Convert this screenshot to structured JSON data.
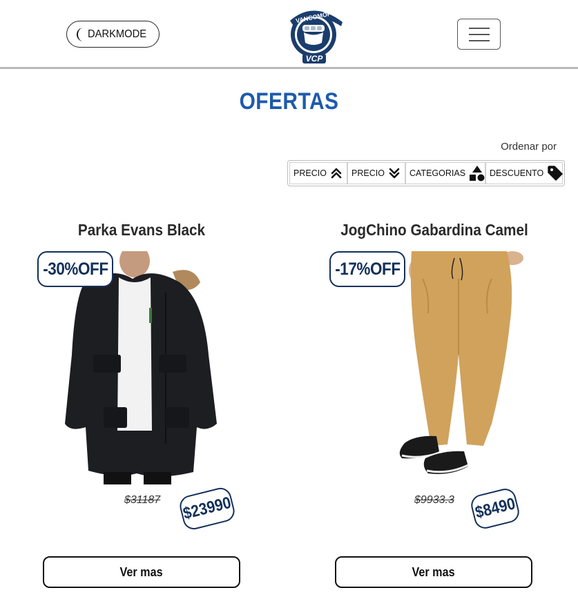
{
  "header": {
    "darkmode_label": "DARKMODE",
    "logo_text_top": "VANCOMOPIÑA",
    "logo_text_bottom": "VCP",
    "menu_icon": "hamburger-icon"
  },
  "main": {
    "title": "OFERTAS",
    "sort": {
      "label": "Ordenar por",
      "options": [
        {
          "label": "PRECIO",
          "icon": "double-chevron-up-icon"
        },
        {
          "label": "PRECIO",
          "icon": "double-chevron-down-icon"
        },
        {
          "label": "CATEGORIAS",
          "icon": "shapes-icon"
        },
        {
          "label": "DESCUENTO",
          "icon": "tag-icon"
        }
      ]
    },
    "products": [
      {
        "name": "Parka Evans Black",
        "discount": "-30%OFF",
        "old_price": "$31187",
        "price": "$23990",
        "button": "Ver mas",
        "image": "black-parka-jacket"
      },
      {
        "name": "JogChino Gabardina Camel",
        "discount": "-17%OFF",
        "old_price": "$9933.3",
        "price": "$8490",
        "button": "Ver mas",
        "image": "camel-jogger-pants"
      }
    ]
  },
  "colors": {
    "title": "#1d5bab",
    "badge": "#12305a",
    "header_border": "#b9b9b9"
  }
}
